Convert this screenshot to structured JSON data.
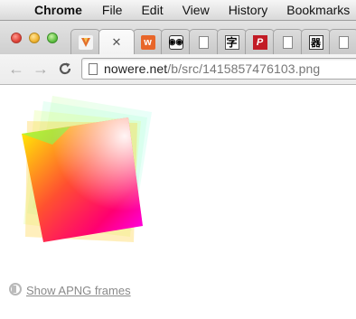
{
  "menubar": {
    "app": "Chrome",
    "items": [
      "File",
      "Edit",
      "View",
      "History",
      "Bookmarks"
    ]
  },
  "tabs": {
    "favicons": [
      "orange-app-icon",
      "close-tab",
      "w-icon",
      "robot-icon",
      "document-icon",
      "kanji-icon",
      "red-p-icon",
      "document-icon",
      "grid-icon",
      "document-icon"
    ],
    "glyphs": {
      "w": "w",
      "robot": "◉◉",
      "kanji": "字",
      "red_p": "P",
      "grid": "器",
      "close": "✕"
    }
  },
  "toolbar": {
    "back": "←",
    "forward": "→",
    "reload": "C",
    "url_host": "nowere.net",
    "url_path": "/b/src/1415857476103.png"
  },
  "content": {
    "image_description_color_stops": [
      "#ffff00",
      "#ff0000",
      "#ff00ff",
      "#ffffff"
    ],
    "link_text": "Show APNG frames"
  }
}
